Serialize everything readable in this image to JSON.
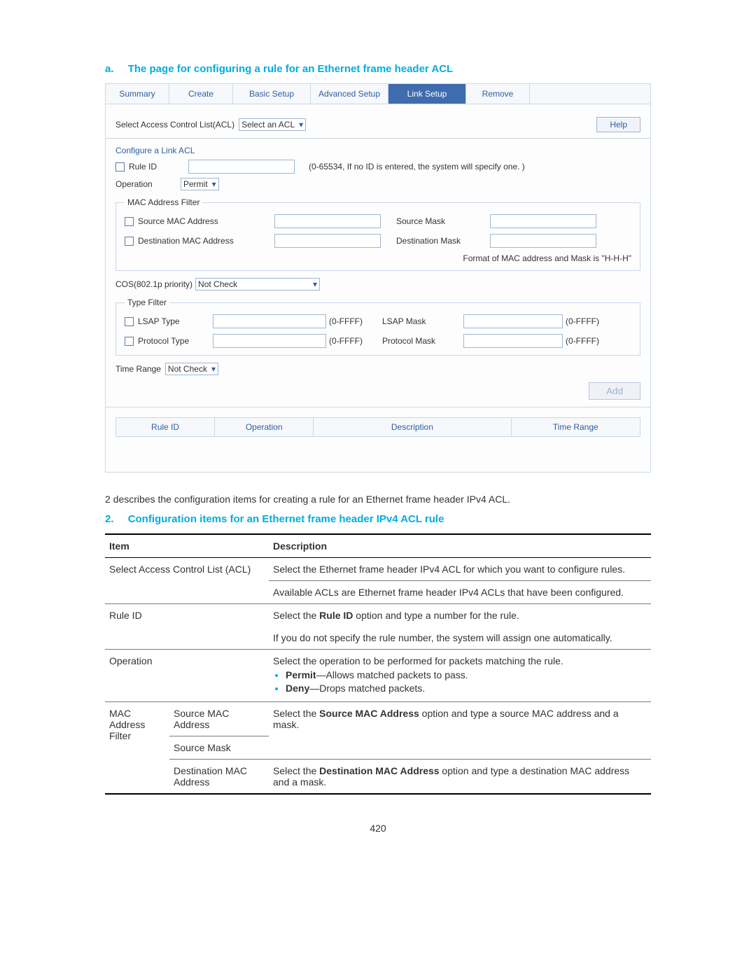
{
  "heading_a": {
    "marker": "a.",
    "text": "The page for configuring a rule for an Ethernet frame header ACL"
  },
  "panel": {
    "tabs": {
      "summary": "Summary",
      "create": "Create",
      "basic": "Basic Setup",
      "advanced": "Advanced Setup",
      "link": "Link Setup",
      "remove": "Remove"
    },
    "acl_label": "Select Access Control List(ACL)",
    "acl_select": "Select an ACL",
    "help": "Help",
    "configure_title": "Configure a Link ACL",
    "rule_id_label": "Rule ID",
    "rule_id_hint": "(0-65534, If no ID is entered, the system will specify one. )",
    "operation_label": "Operation",
    "operation_value": "Permit",
    "mac_filter": {
      "legend": "MAC Address Filter",
      "src_mac_label": "Source MAC Address",
      "src_mask_label": "Source Mask",
      "dst_mac_label": "Destination MAC Address",
      "dst_mask_label": "Destination Mask",
      "format_hint": "Format of MAC address and Mask is \"H-H-H\""
    },
    "cos_label": "COS(802.1p priority)",
    "cos_value": "Not Check",
    "type_filter": {
      "legend": "Type Filter",
      "lsap_type": "LSAP Type",
      "lsap_mask": "LSAP Mask",
      "protocol_type": "Protocol Type",
      "protocol_mask": "Protocol Mask",
      "range": "(0-FFFF)"
    },
    "time_range_label": "Time Range",
    "time_range_value": "Not Check",
    "add_btn": "Add",
    "table_header": {
      "rule_id": "Rule ID",
      "operation": "Operation",
      "description": "Description",
      "time_range": "Time Range"
    }
  },
  "para": "2 describes the configuration items for creating a rule for an Ethernet frame header IPv4 ACL.",
  "heading_2": {
    "marker": "2.",
    "text": "Configuration items for an Ethernet frame header IPv4 ACL rule"
  },
  "table": {
    "head_item": "Item",
    "head_desc": "Description",
    "r1_item": "Select Access Control List (ACL)",
    "r1_d1": "Select the Ethernet frame header IPv4 ACL for which you want to configure rules.",
    "r1_d2": "Available ACLs are Ethernet frame header IPv4 ACLs that have been configured.",
    "r2_item": "Rule ID",
    "r2_d1a": "Select the ",
    "r2_d1b": "Rule ID",
    "r2_d1c": " option and type a number for the rule.",
    "r2_d2": "If you do not specify the rule number, the system will assign one automatically.",
    "r3_item": "Operation",
    "r3_d": "Select the operation to be performed for packets matching the rule.",
    "r3_li1a": "Permit",
    "r3_li1b": "—Allows matched packets to pass.",
    "r3_li2a": "Deny",
    "r3_li2b": "—Drops matched packets.",
    "r4_group": "MAC Address Filter",
    "r4_sub1": "Source MAC Address",
    "r4_sub2": "Source Mask",
    "r4_sub3": "Destination MAC Address",
    "r4_d1a": "Select the ",
    "r4_d1b": "Source MAC Address",
    "r4_d1c": " option and type a source MAC address and a mask.",
    "r4_d2a": "Select the ",
    "r4_d2b": "Destination MAC Address",
    "r4_d2c": " option and type a destination MAC address and a mask."
  },
  "page_number": "420"
}
